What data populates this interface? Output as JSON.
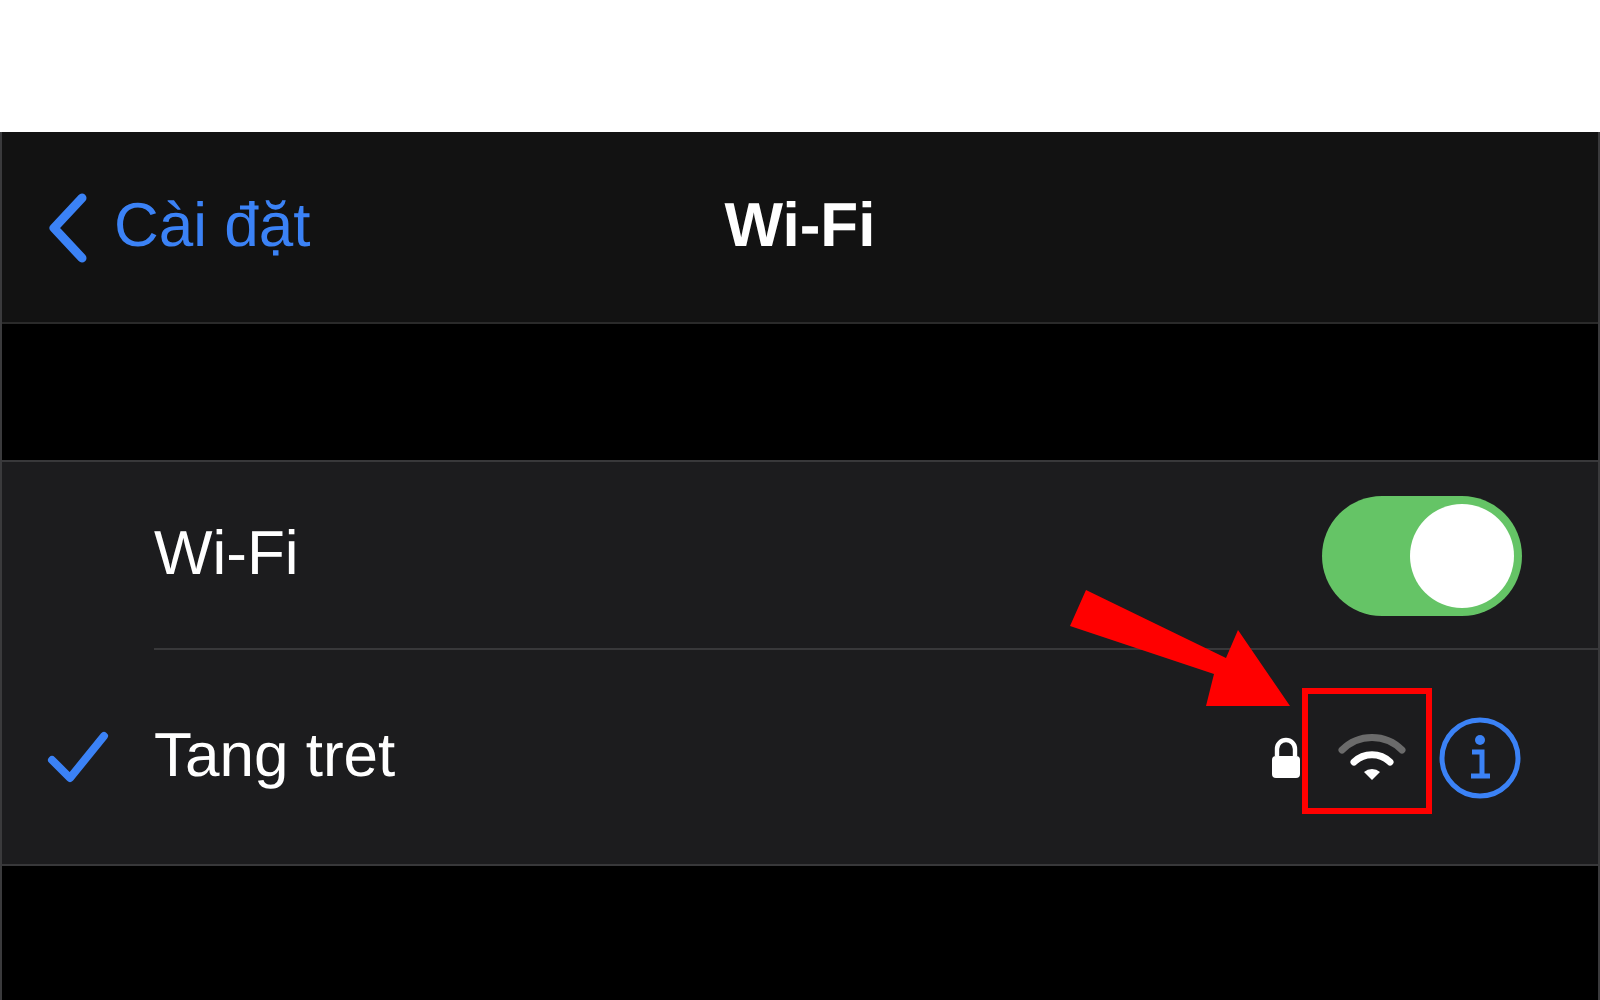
{
  "nav": {
    "back_label": "Cài đặt",
    "title": "Wi-Fi"
  },
  "wifi": {
    "label": "Wi-Fi",
    "on": true
  },
  "networks": [
    {
      "name": "Tang tret",
      "selected": true,
      "locked": true
    }
  ]
}
